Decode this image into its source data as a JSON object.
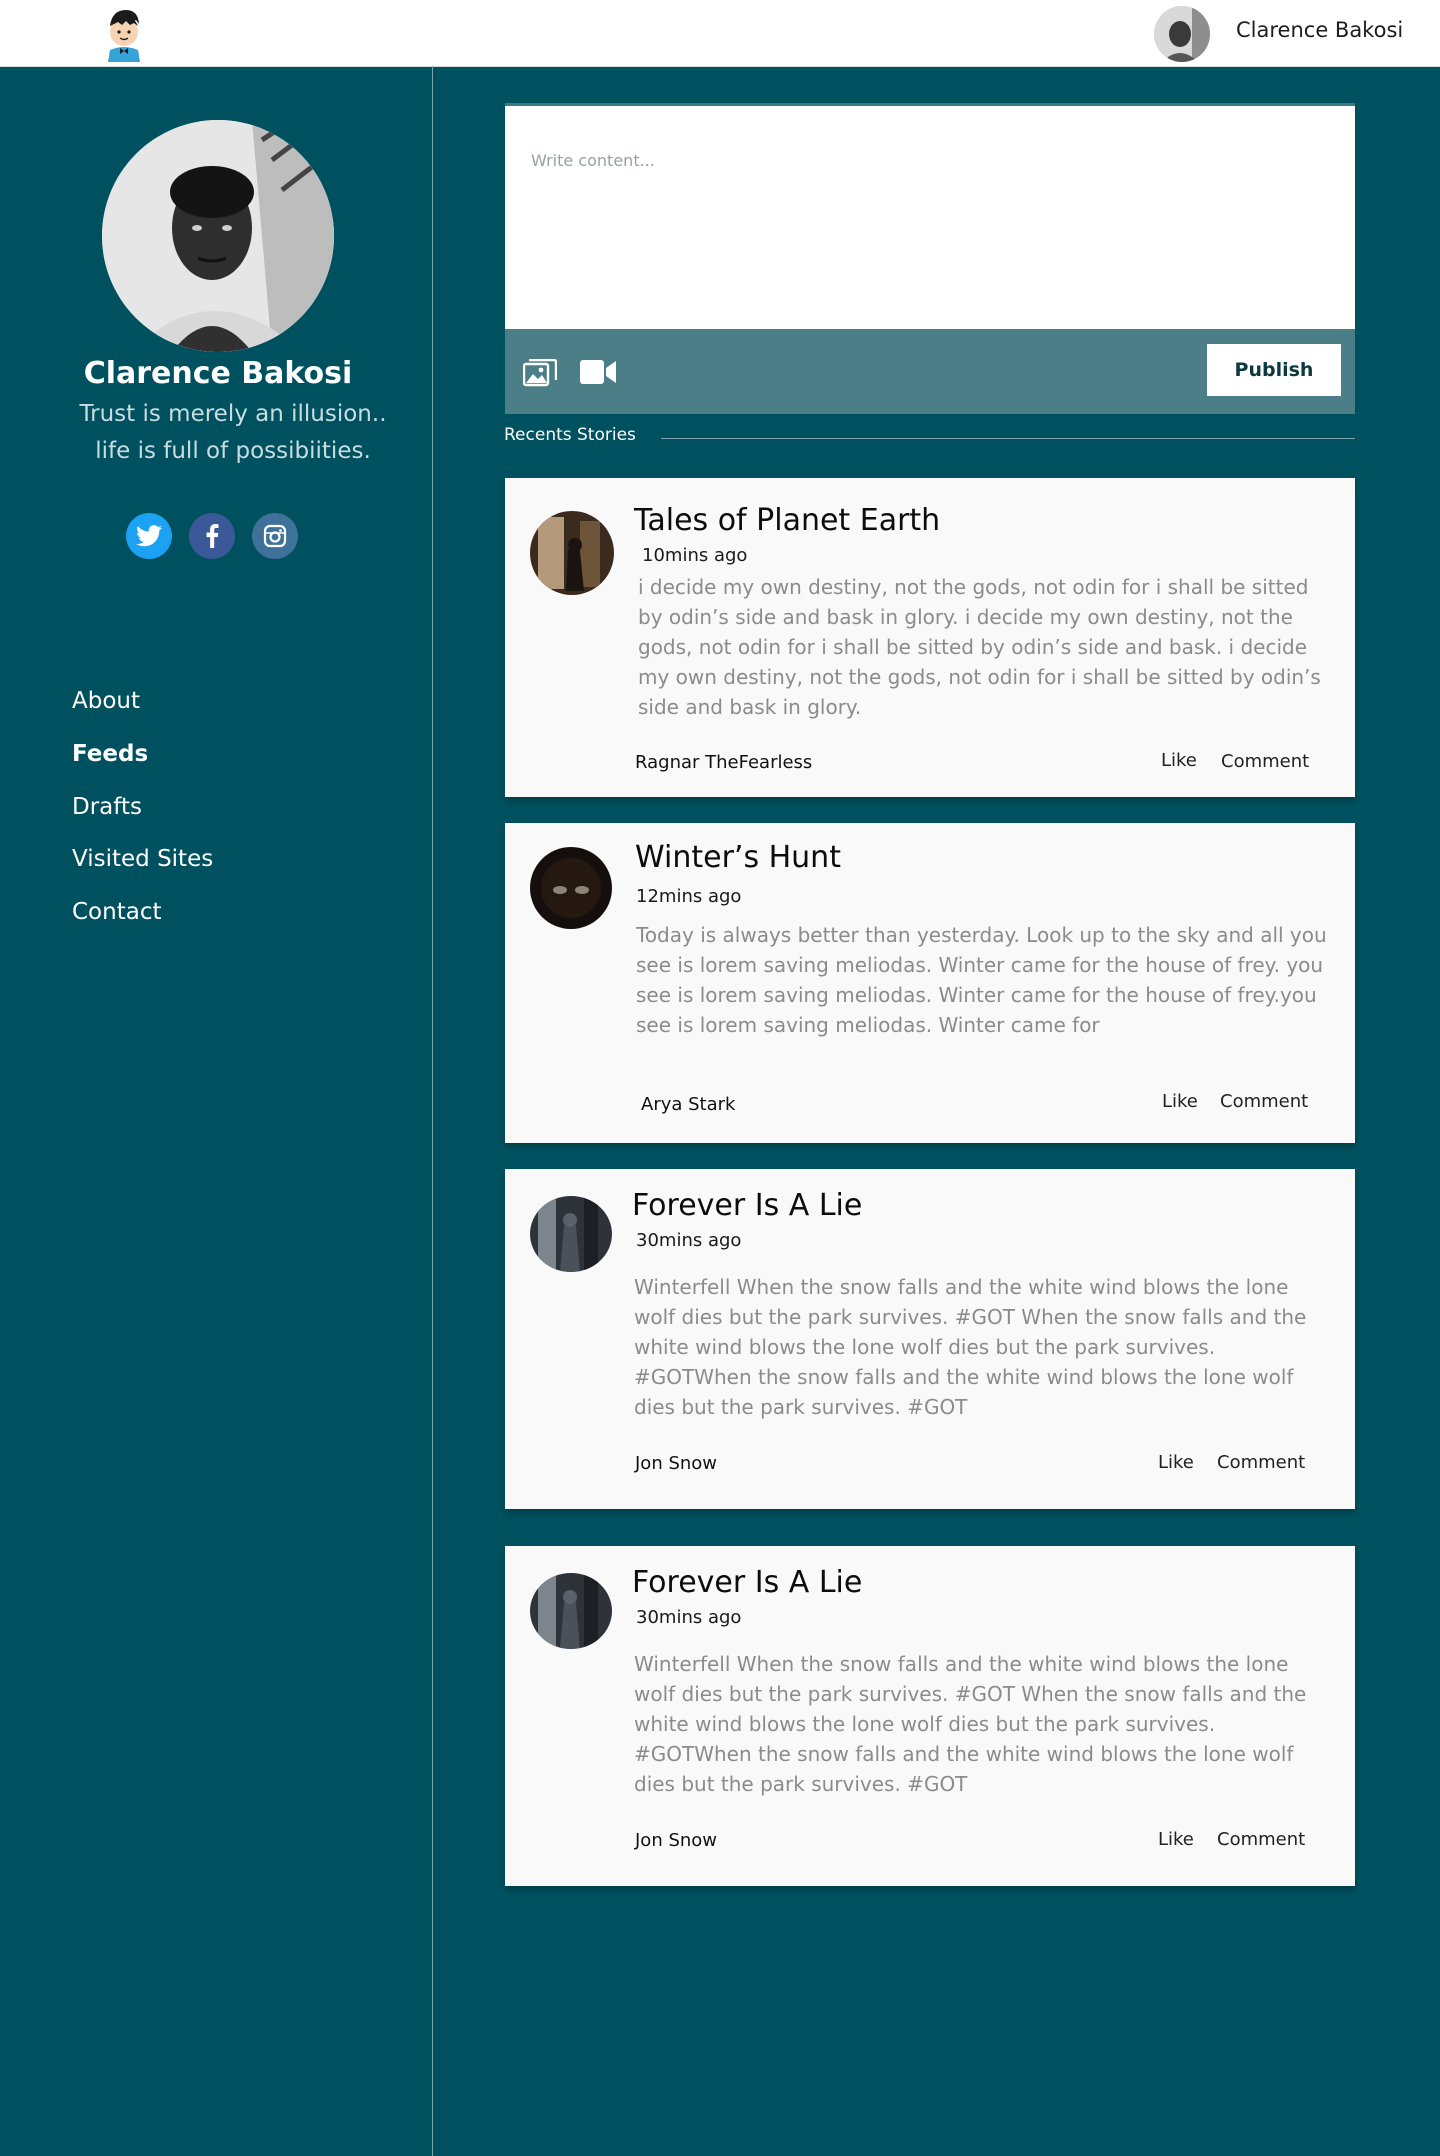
{
  "header": {
    "user_name": "Clarence Bakosi"
  },
  "profile": {
    "name": "Clarence Bakosi",
    "bio_line_1": "Trust is merely an illusion..",
    "bio_line_2": "life is full of possibiities."
  },
  "nav": {
    "items": [
      {
        "label": "About"
      },
      {
        "label": "Feeds"
      },
      {
        "label": "Drafts"
      },
      {
        "label": "Visited Sites"
      },
      {
        "label": "Contact"
      }
    ],
    "active": "Feeds"
  },
  "composer": {
    "placeholder": "Write content...",
    "publish_label": "Publish"
  },
  "section": {
    "recent_label": "Recents Stories"
  },
  "posts": [
    {
      "title": "Tales of Planet Earth",
      "time": "10mins ago",
      "body": "i decide my own destiny,  not the gods, not odin for i shall be sitted by odin’s side and bask in glory.  i decide my own destiny,  not the gods, not odin for i shall be sitted by odin’s side and bask. i decide my own destiny,  not the gods, not odin for i shall be sitted  by odin’s side and bask in glory.",
      "author": "Ragnar TheFearless",
      "like_label": "Like",
      "comment_label": "Comment"
    },
    {
      "title": "Winter’s Hunt",
      "time": "12mins ago",
      "body": "Today is always better than yesterday. Look up to the sky and all you see is lorem saving meliodas. Winter came for  the house of frey. you see is lorem saving meliodas. Winter came for the house of frey.you see is lorem saving meliodas. Winter came for",
      "author": "Arya Stark",
      "like_label": "Like",
      "comment_label": "Comment"
    },
    {
      "title": "Forever Is A Lie",
      "time": "30mins ago",
      "body": "Winterfell When the snow falls and the white wind blows the lone wolf dies but the park survives.  #GOT When the snow falls and the white wind blows the lone wolf  dies  but the park survives. #GOTWhen the snow falls and the white wind blows the lone wolf dies but the park survives.  #GOT",
      "author": "Jon Snow",
      "like_label": "Like",
      "comment_label": "Comment"
    },
    {
      "title": "Forever Is A Lie",
      "time": "30mins ago",
      "body": "Winterfell When the snow falls and the white wind blows the lone wolf dies but the park survives.  #GOT When the snow falls and the white wind blows the lone wolf  dies  but the park survives. #GOTWhen the snow falls and the white wind blows the lone wolf dies but the park survives.  #GOT",
      "author": "Jon Snow",
      "like_label": "Like",
      "comment_label": "Comment"
    }
  ],
  "icons": {
    "logo": "cartoon-boy-logo",
    "twitter": "twitter-icon",
    "facebook": "facebook-icon",
    "instagram": "instagram-icon",
    "image_upload": "image-icon",
    "video_upload": "video-camera-icon"
  },
  "colors": {
    "background": "#005160",
    "toolbar": "#4b7e87",
    "card": "#f9f9f9",
    "twitter": "#1da1f2",
    "facebook": "#3b5998",
    "instagram": "#3f729b"
  }
}
